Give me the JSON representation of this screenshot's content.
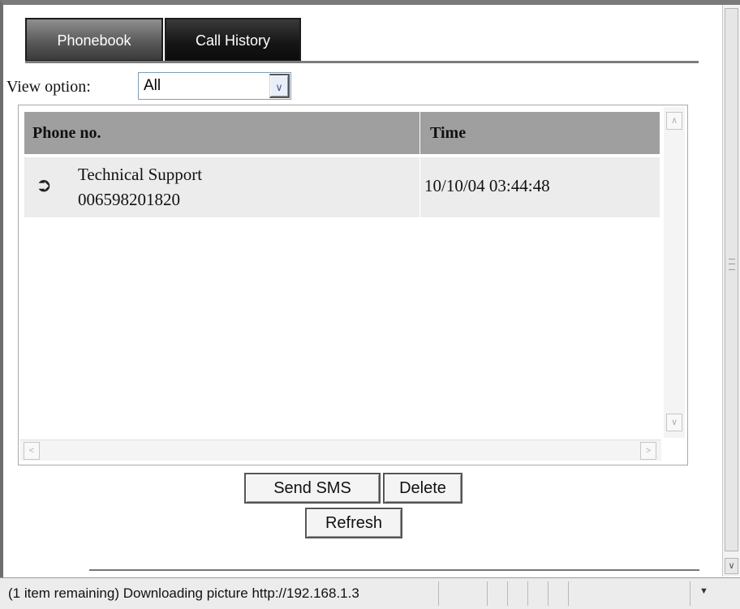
{
  "tabs": [
    {
      "label": "Phonebook",
      "active": false
    },
    {
      "label": "Call History",
      "active": true
    }
  ],
  "view_option": {
    "label": "View option:",
    "selected": "All"
  },
  "table": {
    "columns": [
      "Phone no.",
      "Time"
    ],
    "rows": [
      {
        "direction_icon": "outgoing-call-icon",
        "name": "Technical Support",
        "number": "006598201820",
        "time": "10/10/04 03:44:48"
      }
    ]
  },
  "actions": {
    "send_sms": "Send SMS",
    "delete": "Delete",
    "refresh": "Refresh"
  },
  "status_bar": {
    "text": "(1 item remaining) Downloading picture http://192.168.1.3"
  },
  "colors": {
    "tab_active": "#151515",
    "tab_inactive": "#5a5a5a",
    "header_bg": "#9f9f9f",
    "row_bg": "#ececec"
  }
}
